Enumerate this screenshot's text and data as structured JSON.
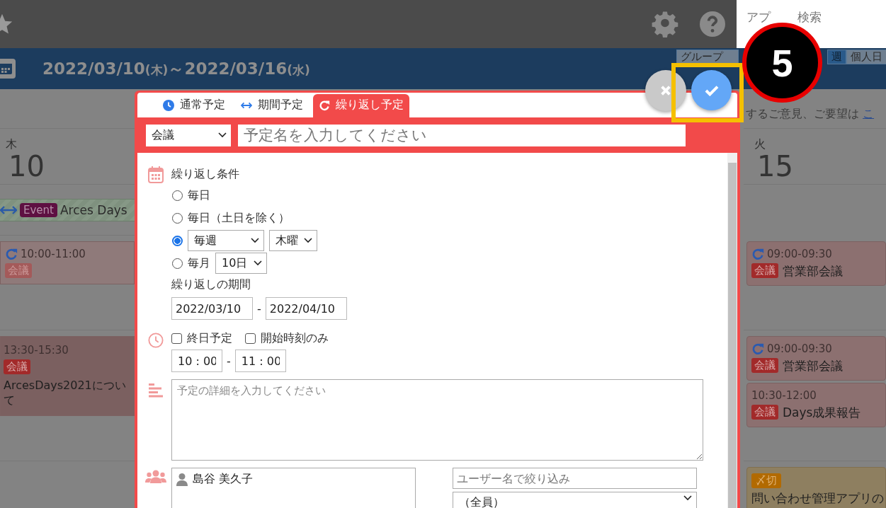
{
  "top_bar": {
    "search_placeholder_start": "アプ",
    "search_placeholder_end": "検索"
  },
  "header": {
    "start_date": "2022/03/10",
    "start_weekday": "(木)",
    "separator": "～",
    "end_date": "2022/03/16",
    "end_weekday": "(水)",
    "view_buttons": [
      {
        "label": "グループ",
        "selected": false
      },
      {
        "label": "週",
        "selected": true
      },
      {
        "label": "個人日",
        "selected": false
      }
    ]
  },
  "calendar": {
    "notice": "するご意見、ご要望は",
    "notice_link": "こ",
    "days": [
      {
        "weekday": "木",
        "day": "10",
        "slots": [
          [
            {
              "kind": "period",
              "tag": "Event",
              "title": "Arces Days"
            }
          ],
          [
            {
              "kind": "schedule",
              "repeat": true,
              "time": "10:00-11:00",
              "tag": "会議"
            }
          ],
          [
            {
              "kind": "schedule",
              "repeat": false,
              "time": "13:30-15:30",
              "tag": "会議",
              "title": "ArcesDays2021について"
            }
          ]
        ]
      },
      {
        "weekday": "火",
        "day": "15",
        "slots": [
          [
            {
              "kind": "schedule",
              "repeat": true,
              "time": "09:00-09:30",
              "tag": "会議",
              "title": "営業部会議"
            }
          ],
          [
            {
              "kind": "schedule",
              "repeat": true,
              "time": "09:00-09:30",
              "tag": "会議",
              "title": "営業部会議"
            },
            {
              "kind": "schedule",
              "repeat": false,
              "time": "10:30-12:00",
              "tag": "会議",
              "title": "Days成果報告"
            }
          ],
          [
            {
              "kind": "deadline",
              "tag": "〆切",
              "title": "問い合わせ管理アプリの"
            }
          ]
        ]
      }
    ]
  },
  "dialog": {
    "tabs": [
      {
        "label": "通常予定",
        "selected": false
      },
      {
        "label": "期間予定",
        "selected": false
      },
      {
        "label": "繰り返し予定",
        "selected": true
      }
    ],
    "category": "会議",
    "title_placeholder": "予定名を入力してください",
    "repeat_label": "繰り返し条件",
    "repeat_options": [
      {
        "kind": "plain",
        "label": "毎日",
        "selected": false
      },
      {
        "kind": "plain",
        "label": "毎日（土日を除く）",
        "selected": false
      },
      {
        "kind": "weekly",
        "unit": "毎週",
        "weekday": "木曜",
        "selected": true
      },
      {
        "kind": "monthly",
        "label": "毎月",
        "day": "10日",
        "selected": false
      }
    ],
    "period_label": "繰り返しの期間",
    "period_start": "2022/03/10",
    "period_separator": "-",
    "period_end": "2022/04/10",
    "time_checks": [
      {
        "label": "終日予定",
        "checked": false
      },
      {
        "label": "開始時刻のみ",
        "checked": false
      }
    ],
    "start_time": "10 : 00",
    "time_separator": "-",
    "end_time": "11 : 00",
    "detail_placeholder": "予定の詳細を入力してください",
    "members": [
      "島谷 美久子"
    ],
    "user_filter_placeholder": "ユーザー名で絞り込み",
    "group_select": "（全員）"
  },
  "step_badge": "5"
}
